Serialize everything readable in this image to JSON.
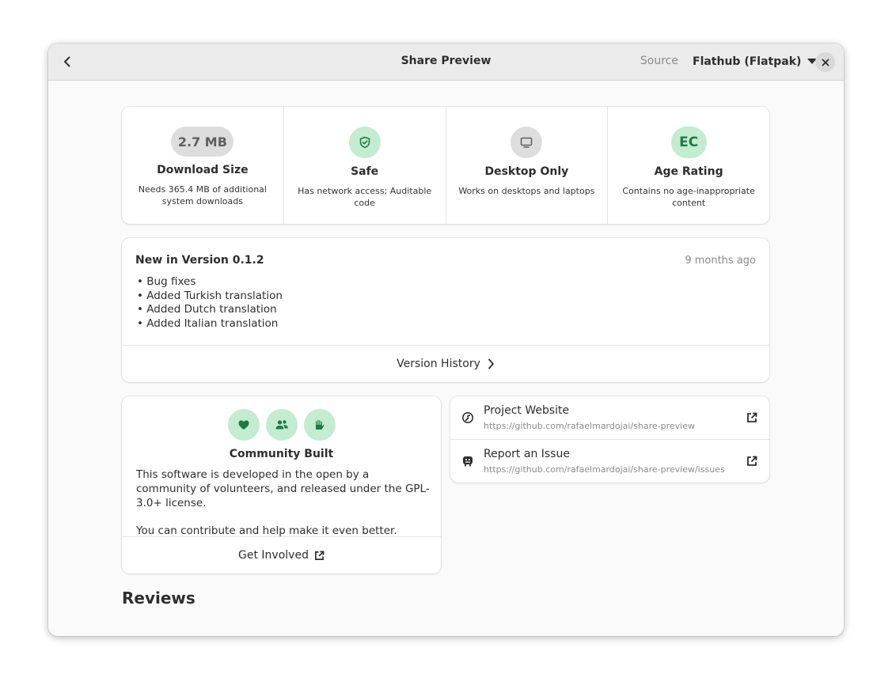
{
  "header": {
    "title": "Share Preview",
    "source_label": "Source",
    "source_value": "Flathub (Flatpak)"
  },
  "tiles": [
    {
      "badge": "2.7 MB",
      "title": "Download Size",
      "desc": "Needs 365.4 MB of additional system downloads",
      "badge_color": "#dedddd"
    },
    {
      "icon": "shield-icon",
      "title": "Safe",
      "desc": "Has network access; Auditable code",
      "badge_color": "#c3ecd0"
    },
    {
      "icon": "monitor-icon",
      "title": "Desktop Only",
      "desc": "Works on desktops and laptops",
      "badge_color": "#dedddd"
    },
    {
      "badge": "EC",
      "title": "Age Rating",
      "desc": "Contains no age-inappropriate content",
      "badge_color": "#c3ecd0"
    }
  ],
  "release": {
    "title": "New in Version 0.1.2",
    "date": "9 months ago",
    "notes": [
      "Bug fixes",
      "Added Turkish translation",
      "Added Dutch translation",
      "Added Italian translation"
    ],
    "history_label": "Version History"
  },
  "community": {
    "icons": [
      "heart-icon",
      "people-icon",
      "hand-icon"
    ],
    "title": "Community Built",
    "text1": "This software is developed in the open by a community of volunteers, and released under the GPL-3.0+ license.",
    "text2": "You can contribute and help make it even better.",
    "get_involved": "Get Involved"
  },
  "links": [
    {
      "title": "Project Website",
      "url": "https://github.com/rafaelmardojai/share-preview",
      "icon": "globe-icon"
    },
    {
      "title": "Report an Issue",
      "url": "https://github.com/rafaelmardojai/share-preview/issues",
      "icon": "bug-icon"
    }
  ],
  "reviews_heading": "Reviews",
  "colors": {
    "accent_green": "#1f7a45",
    "badge_green": "#c3ecd0",
    "badge_grey": "#dedddd"
  }
}
